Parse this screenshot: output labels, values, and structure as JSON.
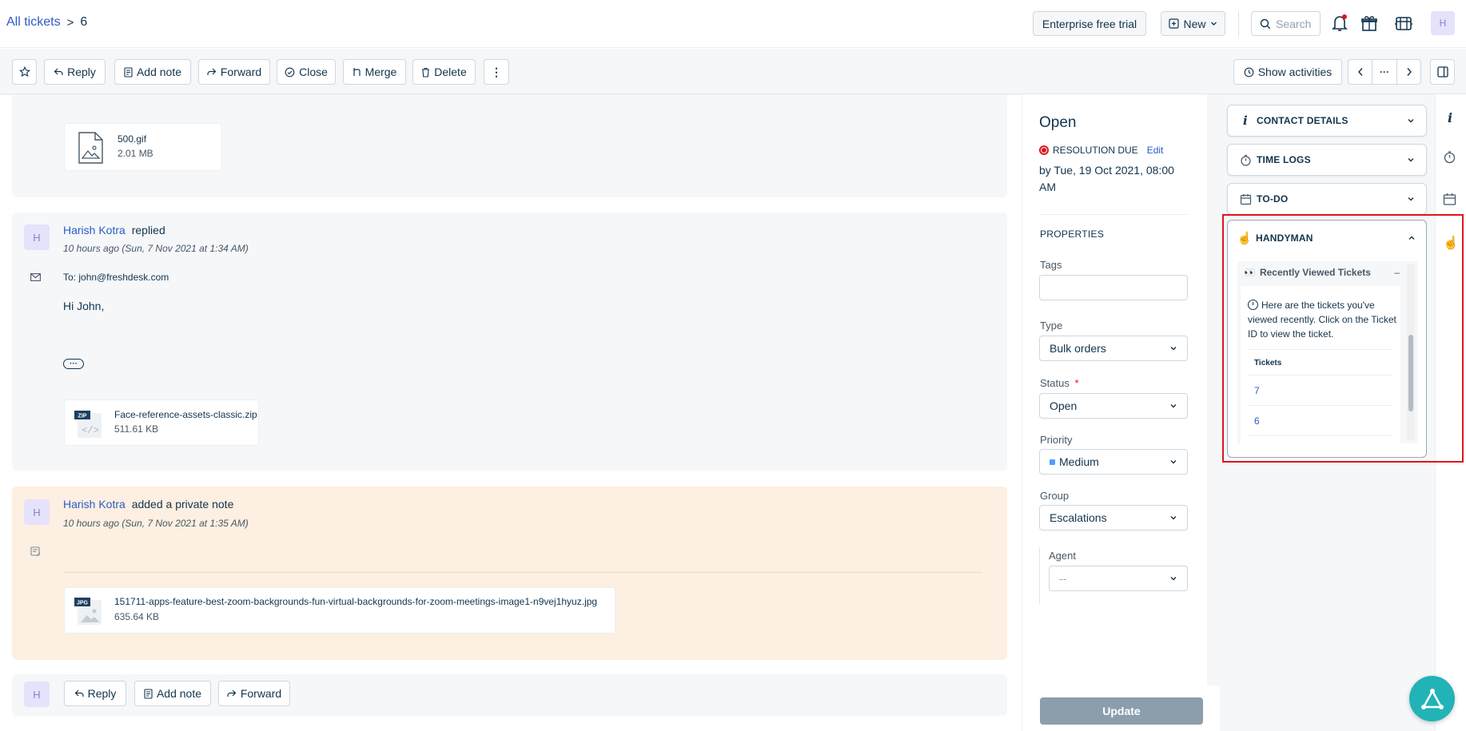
{
  "header": {
    "breadcrumb_root": "All tickets",
    "breadcrumb_sep": ">",
    "ticket_id": "6",
    "trial_label": "Enterprise free trial",
    "new_label": "New",
    "search_placeholder": "Search",
    "avatar_initial": "H"
  },
  "toolbar": {
    "reply": "Reply",
    "add_note": "Add note",
    "forward": "Forward",
    "close": "Close",
    "merge": "Merge",
    "delete": "Delete",
    "more": "⋮",
    "show_activities": "Show activities",
    "nav_more": "···"
  },
  "conversation": {
    "first_attachment": {
      "name": "500.gif",
      "size": "2.01 MB"
    },
    "reply_msg": {
      "avatar": "H",
      "author": "Harish Kotra",
      "action": "replied",
      "time": "10 hours ago (Sun, 7 Nov 2021 at 1:34 AM)",
      "to_label": "To:",
      "to": "john@freshdesk.com",
      "body": "Hi John,",
      "ellipsis": "···",
      "attachment": {
        "badge": "ZIP",
        "name": "Face-reference-assets-classic.zip",
        "size": "511.61 KB"
      }
    },
    "note_msg": {
      "avatar": "H",
      "author": "Harish Kotra",
      "action": "added a private note",
      "time": "10 hours ago (Sun, 7 Nov 2021 at 1:35 AM)",
      "attachment": {
        "badge": "JPG",
        "name": "151711-apps-feature-best-zoom-backgrounds-fun-virtual-backgrounds-for-zoom-meetings-image1-n9vej1hyuz.jpg",
        "size": "635.64 KB"
      }
    },
    "bottom_bar": {
      "avatar": "H",
      "reply": "Reply",
      "add_note": "Add note",
      "forward": "Forward"
    }
  },
  "properties": {
    "status_title": "Open",
    "resolution_label": "RESOLUTION DUE",
    "edit_label": "Edit",
    "due_text": "by Tue, 19 Oct 2021, 08:00 AM",
    "section_title": "PROPERTIES",
    "tags_label": "Tags",
    "type_label": "Type",
    "type_value": "Bulk orders",
    "status_label": "Status",
    "required_mark": "*",
    "status_value": "Open",
    "priority_label": "Priority",
    "priority_value": "Medium",
    "priority_color": "#4d9cff",
    "group_label": "Group",
    "group_value": "Escalations",
    "agent_label": "Agent",
    "agent_value": "--",
    "update_label": "Update"
  },
  "sidebar": {
    "contact_details": "CONTACT DETAILS",
    "time_logs": "TIME LOGS",
    "todo": "TO-DO",
    "handyman": "HANDYMAN",
    "recently_viewed_title": "Recently Viewed Tickets",
    "collapse_symbol": "–",
    "info_text": "Here are the tickets you've viewed recently. Click on the Ticket ID to view the ticket.",
    "tickets_header": "Tickets",
    "tickets": [
      "7",
      "6"
    ]
  },
  "colors": {
    "accent": "#2c5cc5",
    "highlight_border": "#e0141e",
    "note_bg": "#fdefe1",
    "fab": "#22b3b6"
  }
}
